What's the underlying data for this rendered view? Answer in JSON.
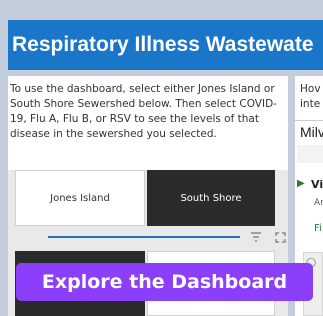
{
  "title": "Respiratory Illness Wastewate",
  "left_panel": {
    "intro_text": "To use the dashboard, select either Jones Island or South Shore Sewershed below. Then select COVID-19, Flu A, Flu B, or RSV to see the levels of that disease in the sewershed you selected.",
    "buttons": {
      "jones_island": "Jones Island",
      "south_shore": "South Shore"
    },
    "icons": {
      "filter": "filter-icon",
      "expand": "expand-icon"
    }
  },
  "right_panel": {
    "text_line1": "Hov",
    "text_line2": "inte",
    "heading": "Milv",
    "item_label": "Vi",
    "item_sub": "Ar",
    "item_link": "Fi",
    "colors": {
      "check": "#2e7d32"
    }
  },
  "cta": {
    "label": "Explore the Dashboard",
    "color": "#8b3ffb"
  },
  "colors": {
    "title_bar": "#1976c9",
    "dark_button": "#2b2b2b",
    "divider": "#2c6fb8"
  }
}
